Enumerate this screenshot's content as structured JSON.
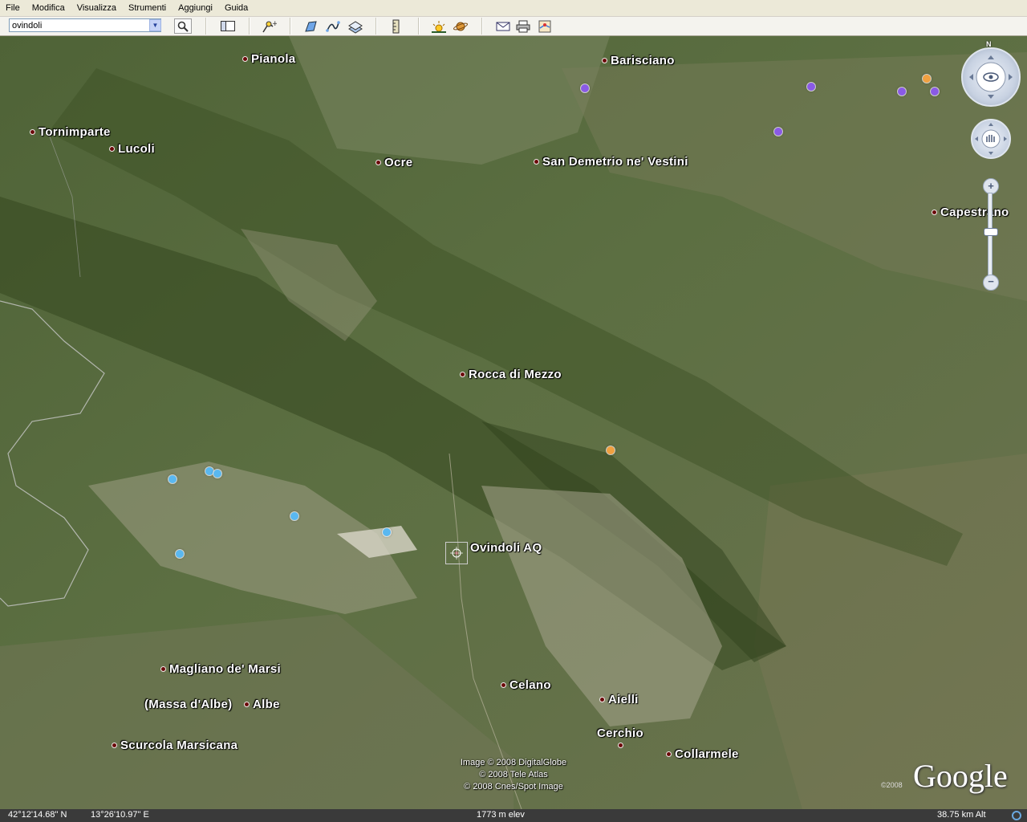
{
  "menu": [
    "File",
    "Modifica",
    "Visualizza",
    "Strumenti",
    "Aggiungi",
    "Guida"
  ],
  "search": {
    "value": "ovindoli"
  },
  "toolbar_icons": [
    "sidebar-icon",
    "placemark-icon",
    "polygon-icon",
    "path-icon",
    "image-overlay-icon",
    "ruler-icon",
    "sun-icon",
    "planet-icon",
    "email-icon",
    "print-icon",
    "maps-icon"
  ],
  "places": [
    {
      "name": "Pianola"
    },
    {
      "name": "Barisciano"
    },
    {
      "name": "Tornimparte"
    },
    {
      "name": "Lucoli"
    },
    {
      "name": "Ocre"
    },
    {
      "name": "San Demetrio ne' Vestini"
    },
    {
      "name": "Capestrano"
    },
    {
      "name": "Rocca di Mezzo"
    },
    {
      "name": "Ovindoli AQ"
    },
    {
      "name": "Magliano de' Marsi"
    },
    {
      "name": "(Massa d'Albe)"
    },
    {
      "name": "Albe"
    },
    {
      "name": "Scurcola Marsicana"
    },
    {
      "name": "Celano"
    },
    {
      "name": "Aielli"
    },
    {
      "name": "Cerchio"
    },
    {
      "name": "Collarmele"
    }
  ],
  "credits": [
    "Image © 2008 DigitalGlobe",
    "© 2008 Tele Atlas",
    "© 2008 Cnes/Spot Image"
  ],
  "logo": "Google",
  "logo_copyright": "©2008",
  "status": {
    "lat": "42°12'14.68\" N",
    "lon": "13°26'10.97\" E",
    "elev": "1773 m elev",
    "alt": "38.75 km Alt"
  },
  "nav": {
    "north": "N"
  }
}
